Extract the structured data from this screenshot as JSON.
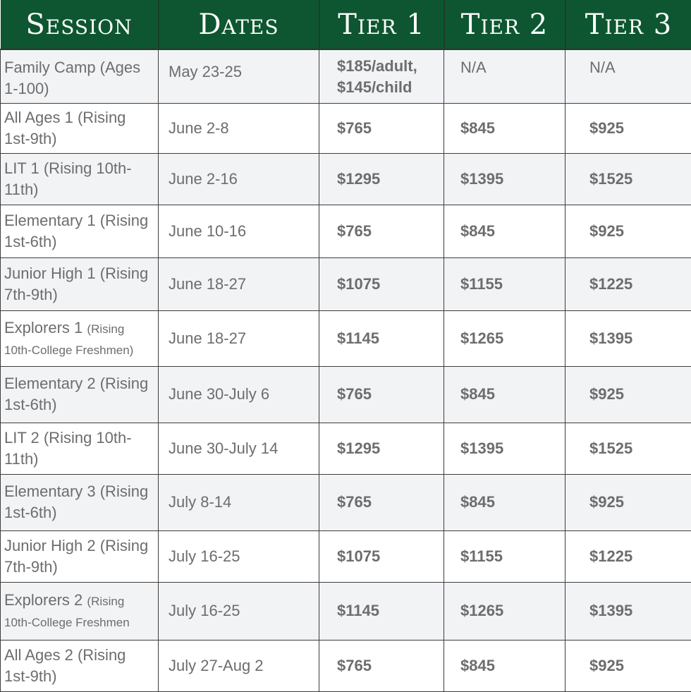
{
  "headers": [
    "Session",
    "Dates",
    "Tier 1",
    "Tier 2",
    "Tier 3"
  ],
  "rows": [
    {
      "session": "Family Camp (Ages 1-100)",
      "dates": "May 23-25",
      "tier1": "$185/adult, $145/child",
      "tier2": "N/A",
      "tier3": "N/A"
    },
    {
      "session": "All Ages 1 (Rising 1st-9th)",
      "dates": "June 2-8",
      "tier1": "$765",
      "tier2": "$845",
      "tier3": "$925"
    },
    {
      "session": "LIT 1 (Rising 10th-11th)",
      "dates": "June 2-16",
      "tier1": "$1295",
      "tier2": "$1395",
      "tier3": "$1525"
    },
    {
      "session": "Elementary 1 (Rising 1st-6th)",
      "dates": "June 10-16",
      "tier1": "$765",
      "tier2": "$845",
      "tier3": "$925"
    },
    {
      "session": "Junior High 1 (Rising 7th-9th)",
      "dates": "June 18-27",
      "tier1": "$1075",
      "tier2": "$1155",
      "tier3": "$1225"
    },
    {
      "session": "Explorers 1",
      "session_note": "(Rising 10th-College Freshmen)",
      "dates": "June 18-27",
      "tier1": "$1145",
      "tier2": "$1265",
      "tier3": "$1395"
    },
    {
      "session": "Elementary 2 (Rising 1st-6th)",
      "dates": "June 30-July 6",
      "tier1": "$765",
      "tier2": "$845",
      "tier3": "$925"
    },
    {
      "session": "LIT 2 (Rising 10th-11th)",
      "dates": "June 30-July 14",
      "tier1": "$1295",
      "tier2": "$1395",
      "tier3": "$1525"
    },
    {
      "session": "Elementary 3 (Rising 1st-6th)",
      "dates": "July 8-14",
      "tier1": "$765",
      "tier2": "$845",
      "tier3": "$925"
    },
    {
      "session": "Junior High 2 (Rising 7th-9th)",
      "dates": "July 16-25",
      "tier1": "$1075",
      "tier2": "$1155",
      "tier3": "$1225"
    },
    {
      "session": "Explorers 2",
      "session_note": "(Rising 10th-College Freshmen",
      "dates": "July 16-25",
      "tier1": "$1145",
      "tier2": "$1265",
      "tier3": "$1395"
    },
    {
      "session": "All Ages 2 (Rising 1st-9th)",
      "dates": "July 27-Aug 2",
      "tier1": "$765",
      "tier2": "$845",
      "tier3": "$925"
    }
  ],
  "colors": {
    "header_bg": "#0d5631",
    "header_text": "#ffffff",
    "body_text": "#6d6d6d",
    "row_alt": "#f2f3f5"
  }
}
